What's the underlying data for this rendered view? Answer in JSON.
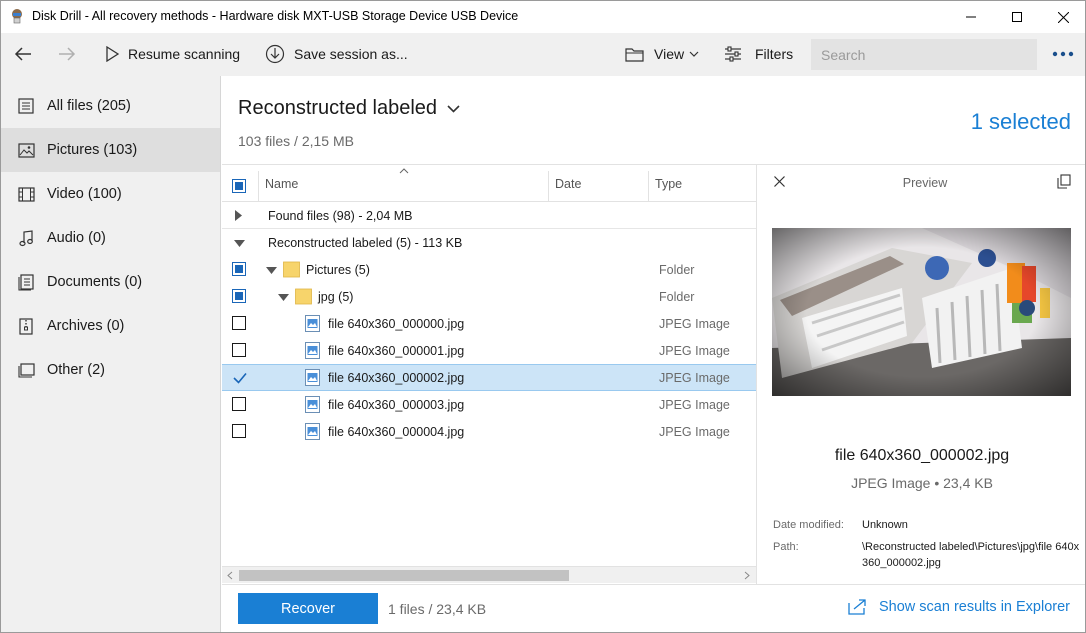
{
  "window": {
    "title": "Disk Drill - All recovery methods - Hardware disk MXT-USB Storage Device USB Device"
  },
  "toolbar": {
    "resume_label": "Resume scanning",
    "save_label": "Save session as...",
    "view_label": "View",
    "filters_label": "Filters",
    "search_placeholder": "Search"
  },
  "sidebar": {
    "items": [
      {
        "label": "All files (205)",
        "icon": "all-files-icon"
      },
      {
        "label": "Pictures (103)",
        "icon": "picture-icon"
      },
      {
        "label": "Video (100)",
        "icon": "video-icon"
      },
      {
        "label": "Audio (0)",
        "icon": "audio-icon"
      },
      {
        "label": "Documents (0)",
        "icon": "document-icon"
      },
      {
        "label": "Archives (0)",
        "icon": "archive-icon"
      },
      {
        "label": "Other (2)",
        "icon": "other-icon"
      }
    ],
    "active_index": 1
  },
  "main": {
    "title": "Reconstructed labeled",
    "subtitle": "103 files / 2,15 MB",
    "selected_text": "1 selected"
  },
  "list": {
    "columns": {
      "name": "Name",
      "date": "Date",
      "type": "Type"
    },
    "groups": [
      {
        "label": "Found files (98) - 2,04 MB",
        "expanded": false
      },
      {
        "label": "Reconstructed labeled (5) - 113 KB",
        "expanded": true
      }
    ],
    "rows": [
      {
        "name": "Pictures (5)",
        "type": "Folder",
        "kind": "folder",
        "checked": "partial"
      },
      {
        "name": "jpg (5)",
        "type": "Folder",
        "kind": "folder",
        "checked": "partial"
      },
      {
        "name": "file 640x360_000000.jpg",
        "type": "JPEG Image",
        "kind": "file",
        "checked": "none"
      },
      {
        "name": "file 640x360_000001.jpg",
        "type": "JPEG Image",
        "kind": "file",
        "checked": "none"
      },
      {
        "name": "file 640x360_000002.jpg",
        "type": "JPEG Image",
        "kind": "file",
        "checked": "checked"
      },
      {
        "name": "file 640x360_000003.jpg",
        "type": "JPEG Image",
        "kind": "file",
        "checked": "none"
      },
      {
        "name": "file 640x360_000004.jpg",
        "type": "JPEG Image",
        "kind": "file",
        "checked": "none"
      }
    ]
  },
  "preview": {
    "title": "Preview",
    "file_name": "file 640x360_000002.jpg",
    "file_info": "JPEG Image • 23,4 KB",
    "date_label": "Date modified:",
    "date_value": "Unknown",
    "path_label": "Path:",
    "path_value": "\\Reconstructed labeled\\Pictures\\jpg\\file 640x360_000002.jpg"
  },
  "bottom": {
    "recover_label": "Recover",
    "info": "1 files / 23,4 KB",
    "explorer_label": "Show scan results in Explorer"
  },
  "colors": {
    "accent": "#1a7fd4",
    "selection": "#cce4f7",
    "sidebar_bg": "#f0f0f0"
  }
}
